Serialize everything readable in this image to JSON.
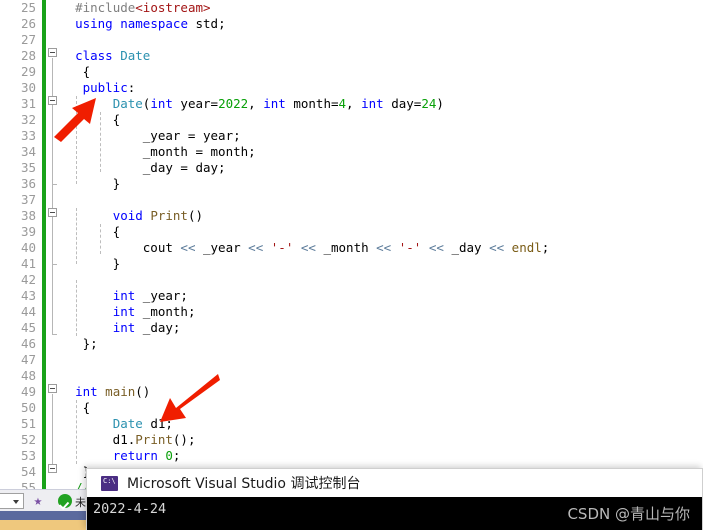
{
  "editor": {
    "first_line_number": 25,
    "lines": [
      {
        "n": 25,
        "segments": [
          {
            "t": "  ",
            "c": "plain"
          },
          {
            "t": "#include",
            "c": "pre"
          },
          {
            "t": "<iostream>",
            "c": "incl"
          }
        ]
      },
      {
        "n": 26,
        "segments": [
          {
            "t": "  ",
            "c": "plain"
          },
          {
            "t": "using",
            "c": "kw"
          },
          {
            "t": " ",
            "c": "plain"
          },
          {
            "t": "namespace",
            "c": "kw"
          },
          {
            "t": " std;",
            "c": "plain"
          }
        ]
      },
      {
        "n": 27,
        "segments": [
          {
            "t": "",
            "c": "plain"
          }
        ]
      },
      {
        "n": 28,
        "segments": [
          {
            "t": "  ",
            "c": "plain"
          },
          {
            "t": "class",
            "c": "kw"
          },
          {
            "t": " ",
            "c": "plain"
          },
          {
            "t": "Date",
            "c": "type"
          }
        ]
      },
      {
        "n": 29,
        "segments": [
          {
            "t": "   {",
            "c": "plain"
          }
        ]
      },
      {
        "n": 30,
        "segments": [
          {
            "t": "   ",
            "c": "plain"
          },
          {
            "t": "public",
            "c": "kw"
          },
          {
            "t": ":",
            "c": "plain"
          }
        ]
      },
      {
        "n": 31,
        "segments": [
          {
            "t": "       ",
            "c": "plain"
          },
          {
            "t": "Date",
            "c": "type"
          },
          {
            "t": "(",
            "c": "plain"
          },
          {
            "t": "int",
            "c": "kw"
          },
          {
            "t": " year=",
            "c": "plain"
          },
          {
            "t": "2022",
            "c": "num"
          },
          {
            "t": ", ",
            "c": "plain"
          },
          {
            "t": "int",
            "c": "kw"
          },
          {
            "t": " month=",
            "c": "plain"
          },
          {
            "t": "4",
            "c": "num"
          },
          {
            "t": ", ",
            "c": "plain"
          },
          {
            "t": "int",
            "c": "kw"
          },
          {
            "t": " day=",
            "c": "plain"
          },
          {
            "t": "24",
            "c": "num"
          },
          {
            "t": ")",
            "c": "plain"
          }
        ]
      },
      {
        "n": 32,
        "segments": [
          {
            "t": "       {",
            "c": "plain"
          }
        ]
      },
      {
        "n": 33,
        "segments": [
          {
            "t": "           _year = year;",
            "c": "plain"
          }
        ]
      },
      {
        "n": 34,
        "segments": [
          {
            "t": "           _month = month;",
            "c": "plain"
          }
        ]
      },
      {
        "n": 35,
        "segments": [
          {
            "t": "           _day = day;",
            "c": "plain"
          }
        ]
      },
      {
        "n": 36,
        "segments": [
          {
            "t": "       }",
            "c": "plain"
          }
        ]
      },
      {
        "n": 37,
        "segments": [
          {
            "t": "",
            "c": "plain"
          }
        ]
      },
      {
        "n": 38,
        "segments": [
          {
            "t": "       ",
            "c": "plain"
          },
          {
            "t": "void",
            "c": "kw"
          },
          {
            "t": " ",
            "c": "plain"
          },
          {
            "t": "Print",
            "c": "fn"
          },
          {
            "t": "()",
            "c": "plain"
          }
        ]
      },
      {
        "n": 39,
        "segments": [
          {
            "t": "       {",
            "c": "plain"
          }
        ]
      },
      {
        "n": 40,
        "segments": [
          {
            "t": "           cout ",
            "c": "plain"
          },
          {
            "t": "<<",
            "c": "op"
          },
          {
            "t": " _year ",
            "c": "plain"
          },
          {
            "t": "<<",
            "c": "op"
          },
          {
            "t": " ",
            "c": "plain"
          },
          {
            "t": "'-'",
            "c": "str"
          },
          {
            "t": " ",
            "c": "plain"
          },
          {
            "t": "<<",
            "c": "op"
          },
          {
            "t": " _month ",
            "c": "plain"
          },
          {
            "t": "<<",
            "c": "op"
          },
          {
            "t": " ",
            "c": "plain"
          },
          {
            "t": "'-'",
            "c": "str"
          },
          {
            "t": " ",
            "c": "plain"
          },
          {
            "t": "<<",
            "c": "op"
          },
          {
            "t": " _day ",
            "c": "plain"
          },
          {
            "t": "<<",
            "c": "op"
          },
          {
            "t": " ",
            "c": "plain"
          },
          {
            "t": "endl",
            "c": "endl"
          },
          {
            "t": ";",
            "c": "plain"
          }
        ]
      },
      {
        "n": 41,
        "segments": [
          {
            "t": "       }",
            "c": "plain"
          }
        ]
      },
      {
        "n": 42,
        "segments": [
          {
            "t": "",
            "c": "plain"
          }
        ]
      },
      {
        "n": 43,
        "segments": [
          {
            "t": "       ",
            "c": "plain"
          },
          {
            "t": "int",
            "c": "kw"
          },
          {
            "t": " _year;",
            "c": "plain"
          }
        ]
      },
      {
        "n": 44,
        "segments": [
          {
            "t": "       ",
            "c": "plain"
          },
          {
            "t": "int",
            "c": "kw"
          },
          {
            "t": " _month;",
            "c": "plain"
          }
        ]
      },
      {
        "n": 45,
        "segments": [
          {
            "t": "       ",
            "c": "plain"
          },
          {
            "t": "int",
            "c": "kw"
          },
          {
            "t": " _day;",
            "c": "plain"
          }
        ]
      },
      {
        "n": 46,
        "segments": [
          {
            "t": "   };",
            "c": "plain"
          }
        ]
      },
      {
        "n": 47,
        "segments": [
          {
            "t": "",
            "c": "plain"
          }
        ]
      },
      {
        "n": 48,
        "segments": [
          {
            "t": "",
            "c": "plain"
          }
        ]
      },
      {
        "n": 49,
        "segments": [
          {
            "t": "  ",
            "c": "plain"
          },
          {
            "t": "int",
            "c": "kw"
          },
          {
            "t": " ",
            "c": "plain"
          },
          {
            "t": "main",
            "c": "fn"
          },
          {
            "t": "()",
            "c": "plain"
          }
        ]
      },
      {
        "n": 50,
        "segments": [
          {
            "t": "   {",
            "c": "plain"
          }
        ]
      },
      {
        "n": 51,
        "segments": [
          {
            "t": "       ",
            "c": "plain"
          },
          {
            "t": "Date",
            "c": "type"
          },
          {
            "t": " d1;",
            "c": "plain"
          }
        ]
      },
      {
        "n": 52,
        "segments": [
          {
            "t": "       d1.",
            "c": "plain"
          },
          {
            "t": "Print",
            "c": "fn"
          },
          {
            "t": "();",
            "c": "plain"
          }
        ]
      },
      {
        "n": 53,
        "segments": [
          {
            "t": "       ",
            "c": "plain"
          },
          {
            "t": "return",
            "c": "kw"
          },
          {
            "t": " ",
            "c": "plain"
          },
          {
            "t": "0",
            "c": "num"
          },
          {
            "t": ";",
            "c": "plain"
          }
        ]
      },
      {
        "n": 54,
        "segments": [
          {
            "t": "   }",
            "c": "plain"
          }
        ]
      },
      {
        "n": 55,
        "segments": [
          {
            "t": "  ",
            "c": "plain"
          },
          {
            "t": "//int",
            "c": "cmt"
          }
        ]
      }
    ]
  },
  "console": {
    "title": "Microsoft Visual Studio 调试控制台",
    "icon": "console-app-icon",
    "output": "2022-4-24"
  },
  "watermark": {
    "text": "CSDN @青山与你"
  },
  "status_bar": {
    "build_status_text": "未",
    "build_status_icon": "green-check-icon",
    "tool_icon": "debug-history-icon",
    "combo_caret_icon": "chevron-down-icon"
  },
  "annotations": {
    "arrow_1_target": "Date-constructor-declaration",
    "arrow_2_target": "Date-d1-object-declaration",
    "arrow_color": "#f01e00"
  },
  "colors": {
    "keyword": "#0000ff",
    "type": "#2b91af",
    "function": "#795e26",
    "number": "#09a009",
    "string": "#a31515",
    "comment": "#1d9e1d",
    "operator": "#5a7a99",
    "line_number": "#9a9a9a",
    "change_bar": "#19a219",
    "console_bg": "#000000"
  }
}
